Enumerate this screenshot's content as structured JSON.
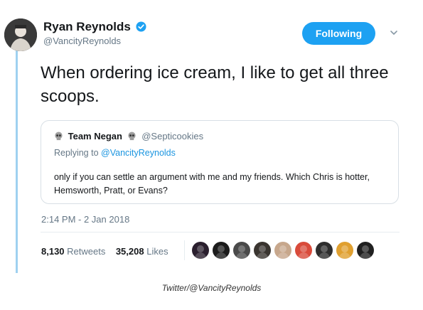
{
  "user": {
    "name": "Ryan Reynolds",
    "handle": "@VancityReynolds",
    "verified": true,
    "avatar_icon": "profile-photo"
  },
  "follow_button": {
    "label": "Following",
    "color": "#1da1f2"
  },
  "menu_icon": "chevron-down-icon",
  "tweet": {
    "text": "When ordering ice cream, I like to get all three scoops."
  },
  "quoted": {
    "name": "Team Negan",
    "handle": "@Septicookies",
    "replying_prefix": "Replying to ",
    "replying_to": "@VancityReynolds",
    "text": "only if you can settle an argument with me and my friends. Which Chris is hotter, Hemsworth, Pratt, or Evans?"
  },
  "timestamp": "2:14 PM - 2 Jan 2018",
  "stats": {
    "retweets_count": "8,130",
    "retweets_label": "Retweets",
    "likes_count": "35,208",
    "likes_label": "Likes"
  },
  "likers": [
    {
      "icon": "liker-avatar-1",
      "color": "#2a1f2e"
    },
    {
      "icon": "liker-avatar-2",
      "color": "#1c1c1c"
    },
    {
      "icon": "liker-avatar-3",
      "color": "#4a4a4a"
    },
    {
      "icon": "liker-avatar-4",
      "color": "#3a3530"
    },
    {
      "icon": "liker-avatar-5",
      "color": "#c7a78c"
    },
    {
      "icon": "liker-avatar-6",
      "color": "#d94b3b"
    },
    {
      "icon": "liker-avatar-7",
      "color": "#2e2e2e"
    },
    {
      "icon": "liker-avatar-8",
      "color": "#e0a030"
    },
    {
      "icon": "liker-avatar-9",
      "color": "#202020"
    }
  ],
  "credit": "Twitter/@VancityReynolds"
}
